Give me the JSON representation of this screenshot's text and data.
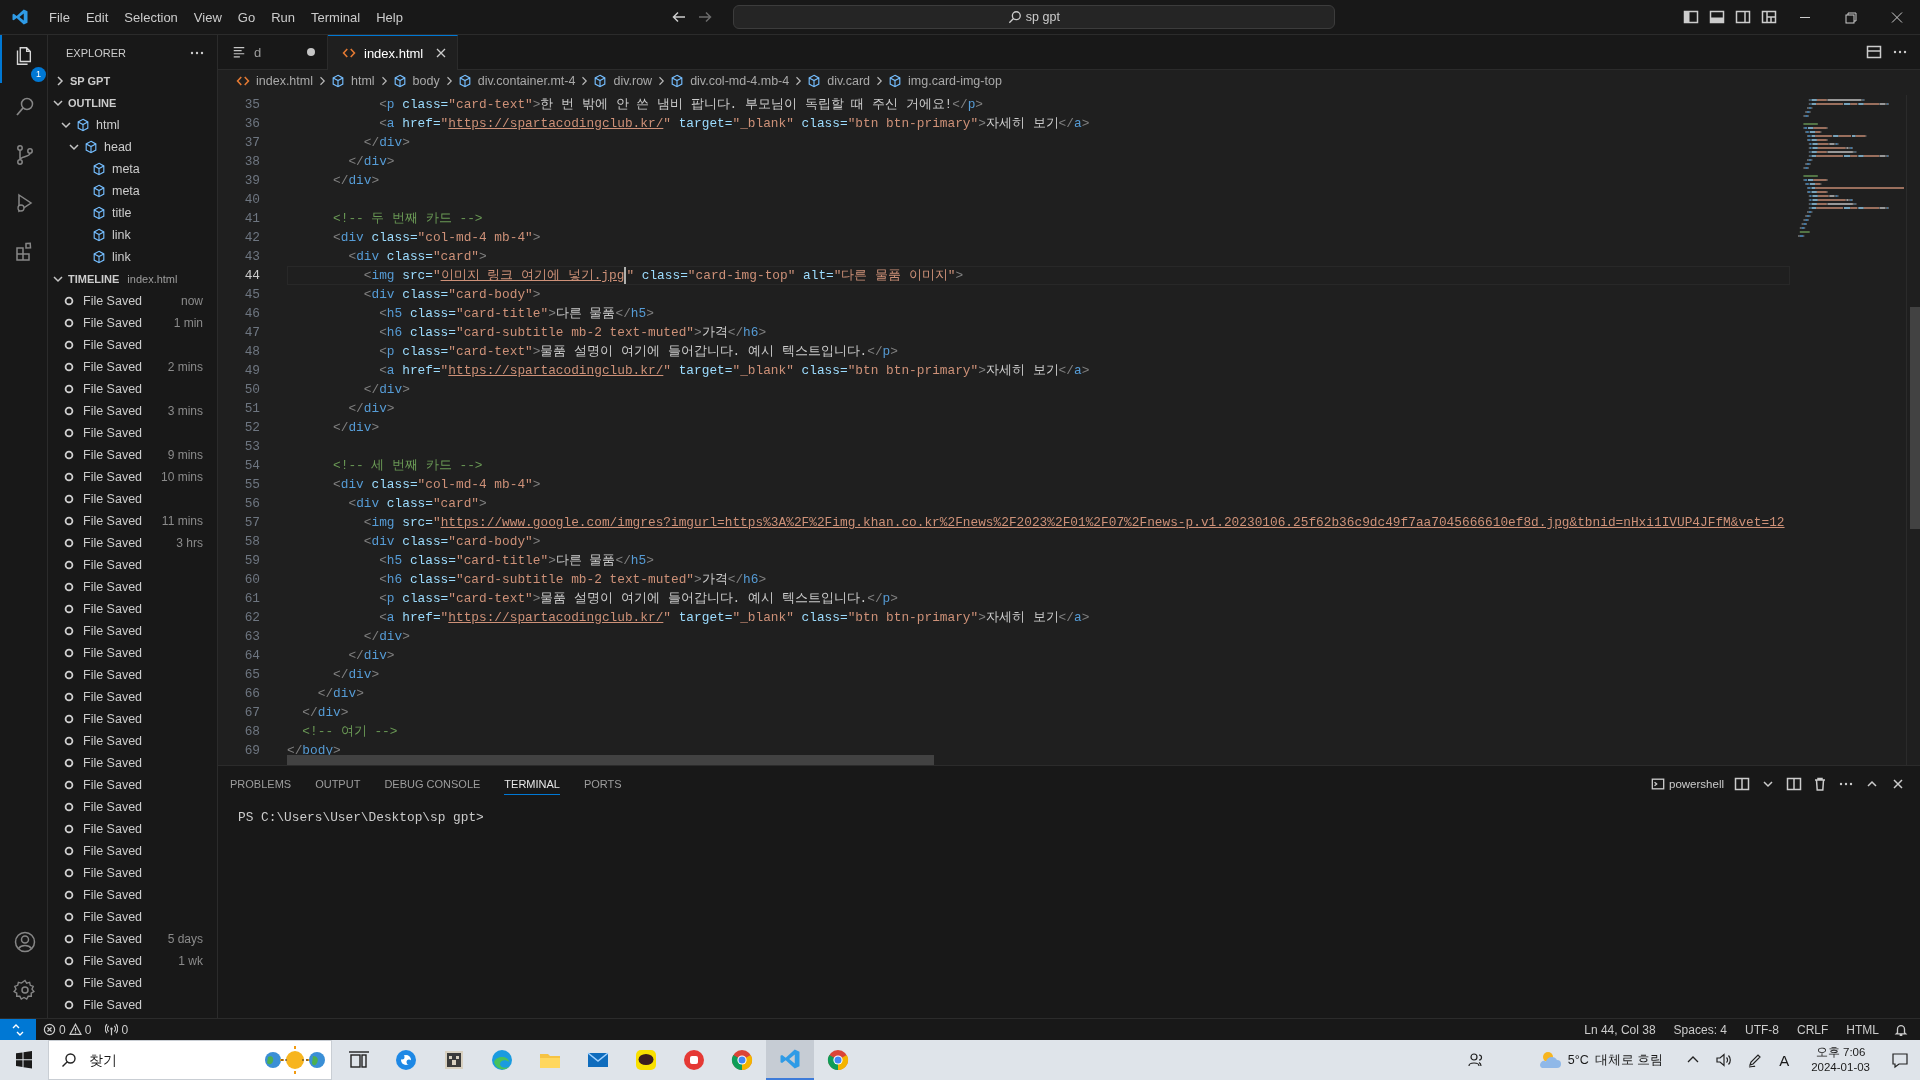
{
  "title_bar": {
    "menu": [
      "File",
      "Edit",
      "Selection",
      "View",
      "Go",
      "Run",
      "Terminal",
      "Help"
    ],
    "command_center": {
      "value": "sp gpt"
    }
  },
  "activity_bar": {
    "items": [
      {
        "kind": "explorer",
        "selected": true,
        "badge": "1"
      },
      {
        "kind": "search",
        "selected": false
      },
      {
        "kind": "source-control",
        "selected": false
      },
      {
        "kind": "run",
        "selected": false
      },
      {
        "kind": "extensions",
        "selected": false
      }
    ],
    "bottom": [
      {
        "kind": "accounts"
      },
      {
        "kind": "manage"
      }
    ]
  },
  "sidebar": {
    "title": "EXPLORER",
    "sections": [
      {
        "kind": "folder",
        "label": "SP GPT",
        "expanded": false
      },
      {
        "kind": "outline",
        "label": "OUTLINE",
        "expanded": true,
        "items": [
          {
            "label": "html",
            "expanded": true,
            "children": [
              {
                "label": "head",
                "expanded": true,
                "children": [
                  {
                    "label": "meta"
                  },
                  {
                    "label": "meta"
                  },
                  {
                    "label": "title"
                  },
                  {
                    "label": "link"
                  },
                  {
                    "label": "link"
                  }
                ]
              }
            ]
          }
        ]
      },
      {
        "kind": "timeline",
        "label": "TIMELINE",
        "file": "index.html",
        "expanded": true,
        "items": [
          {
            "label": "File Saved",
            "time": "now"
          },
          {
            "label": "File Saved",
            "time": "1 min"
          },
          {
            "label": "File Saved"
          },
          {
            "label": "File Saved",
            "time": "2 mins"
          },
          {
            "label": "File Saved"
          },
          {
            "label": "File Saved",
            "time": "3 mins"
          },
          {
            "label": "File Saved"
          },
          {
            "label": "File Saved",
            "time": "9 mins"
          },
          {
            "label": "File Saved",
            "time": "10 mins"
          },
          {
            "label": "File Saved"
          },
          {
            "label": "File Saved",
            "time": "11 mins"
          },
          {
            "label": "File Saved",
            "time": "3 hrs"
          },
          {
            "label": "File Saved"
          },
          {
            "label": "File Saved"
          },
          {
            "label": "File Saved"
          },
          {
            "label": "File Saved"
          },
          {
            "label": "File Saved"
          },
          {
            "label": "File Saved"
          },
          {
            "label": "File Saved"
          },
          {
            "label": "File Saved"
          },
          {
            "label": "File Saved"
          },
          {
            "label": "File Saved"
          },
          {
            "label": "File Saved"
          },
          {
            "label": "File Saved"
          },
          {
            "label": "File Saved"
          },
          {
            "label": "File Saved"
          },
          {
            "label": "File Saved"
          },
          {
            "label": "File Saved"
          },
          {
            "label": "File Saved"
          },
          {
            "label": "File Saved",
            "time": "5 days"
          },
          {
            "label": "File Saved",
            "time": "1 wk"
          },
          {
            "label": "File Saved"
          },
          {
            "label": "File Saved"
          }
        ]
      }
    ]
  },
  "editor": {
    "tabs": [
      {
        "label": "d",
        "kind": "text",
        "modified": true,
        "selected": false
      },
      {
        "label": "index.html",
        "kind": "html",
        "modified": false,
        "selected": true
      }
    ],
    "breadcrumbs": [
      {
        "label": "index.html",
        "kind": "file"
      },
      {
        "label": "html",
        "kind": "element"
      },
      {
        "label": "body",
        "kind": "element"
      },
      {
        "label": "div.container.mt-4",
        "kind": "element"
      },
      {
        "label": "div.row",
        "kind": "element"
      },
      {
        "label": "div.col-md-4.mb-4",
        "kind": "element"
      },
      {
        "label": "div.card",
        "kind": "element"
      },
      {
        "label": "img.card-img-top",
        "kind": "element"
      }
    ],
    "lines": [
      {
        "number": "35",
        "current": false,
        "tokens": [
          {
            "kind": "punct",
            "text": "            <"
          },
          {
            "kind": "tag",
            "text": "p"
          },
          {
            "kind": "attr",
            "text": " class="
          },
          {
            "kind": "str",
            "text": "\"card-text\""
          },
          {
            "kind": "punct",
            "text": ">"
          },
          {
            "kind": "text",
            "text": "한 번 밖에 안 쓴 냄비 팝니다. 부모님이 독립할 때 주신 거에요!"
          },
          {
            "kind": "punct",
            "text": "</"
          },
          {
            "kind": "tag",
            "text": "p"
          },
          {
            "kind": "punct",
            "text": ">"
          }
        ]
      },
      {
        "number": "36",
        "current": false,
        "tokens": [
          {
            "kind": "punct",
            "text": "            <"
          },
          {
            "kind": "tag",
            "text": "a"
          },
          {
            "kind": "attr",
            "text": " href="
          },
          {
            "kind": "str",
            "text": "\""
          },
          {
            "kind": "link",
            "text": "https://spartacodingclub.kr/"
          },
          {
            "kind": "str",
            "text": "\""
          },
          {
            "kind": "attr",
            "text": " target="
          },
          {
            "kind": "str",
            "text": "\"_blank\""
          },
          {
            "kind": "attr",
            "text": " class="
          },
          {
            "kind": "str",
            "text": "\"btn btn-primary\""
          },
          {
            "kind": "punct",
            "text": ">"
          },
          {
            "kind": "text",
            "text": "자세히 보기"
          },
          {
            "kind": "punct",
            "text": "</"
          },
          {
            "kind": "tag",
            "text": "a"
          },
          {
            "kind": "punct",
            "text": ">"
          }
        ]
      },
      {
        "number": "37",
        "current": false,
        "tokens": [
          {
            "kind": "punct",
            "text": "          </"
          },
          {
            "kind": "tag",
            "text": "div"
          },
          {
            "kind": "punct",
            "text": ">"
          }
        ]
      },
      {
        "number": "38",
        "current": false,
        "tokens": [
          {
            "kind": "punct",
            "text": "        </"
          },
          {
            "kind": "tag",
            "text": "div"
          },
          {
            "kind": "punct",
            "text": ">"
          }
        ]
      },
      {
        "number": "39",
        "current": false,
        "tokens": [
          {
            "kind": "punct",
            "text": "      </"
          },
          {
            "kind": "tag",
            "text": "div"
          },
          {
            "kind": "punct",
            "text": ">"
          }
        ]
      },
      {
        "number": "40",
        "current": false
      },
      {
        "number": "41",
        "current": false,
        "tokens": [
          {
            "kind": "comment",
            "text": "      <!-- 두 번째 카드 -->"
          }
        ]
      },
      {
        "number": "42",
        "current": false,
        "tokens": [
          {
            "kind": "punct",
            "text": "      <"
          },
          {
            "kind": "tag",
            "text": "div"
          },
          {
            "kind": "attr",
            "text": " class="
          },
          {
            "kind": "str",
            "text": "\"col-md-4 mb-4\""
          },
          {
            "kind": "punct",
            "text": ">"
          }
        ]
      },
      {
        "number": "43",
        "current": false,
        "tokens": [
          {
            "kind": "punct",
            "text": "        <"
          },
          {
            "kind": "tag",
            "text": "div"
          },
          {
            "kind": "attr",
            "text": " class="
          },
          {
            "kind": "str",
            "text": "\"card\""
          },
          {
            "kind": "punct",
            "text": ">"
          }
        ]
      },
      {
        "number": "44",
        "current": true,
        "tokens": [
          {
            "kind": "punct",
            "text": "          <"
          },
          {
            "kind": "tag",
            "text": "img"
          },
          {
            "kind": "attr",
            "text": " src="
          },
          {
            "kind": "str",
            "text": "\""
          },
          {
            "kind": "link",
            "text": "이미지_링크_여기에_넣기.jpg",
            "cursor": true
          },
          {
            "kind": "str",
            "text": "\""
          },
          {
            "kind": "attr",
            "text": " class="
          },
          {
            "kind": "str",
            "text": "\"card-img-top\""
          },
          {
            "kind": "attr",
            "text": " alt="
          },
          {
            "kind": "str",
            "text": "\"다른 물품 이미지\""
          },
          {
            "kind": "punct",
            "text": ">"
          }
        ]
      },
      {
        "number": "45",
        "current": false,
        "tokens": [
          {
            "kind": "punct",
            "text": "          <"
          },
          {
            "kind": "tag",
            "text": "div"
          },
          {
            "kind": "attr",
            "text": " class="
          },
          {
            "kind": "str",
            "text": "\"card-body\""
          },
          {
            "kind": "punct",
            "text": ">"
          }
        ]
      },
      {
        "number": "46",
        "current": false,
        "tokens": [
          {
            "kind": "punct",
            "text": "            <"
          },
          {
            "kind": "tag",
            "text": "h5"
          },
          {
            "kind": "attr",
            "text": " class="
          },
          {
            "kind": "str",
            "text": "\"card-title\""
          },
          {
            "kind": "punct",
            "text": ">"
          },
          {
            "kind": "text",
            "text": "다른 물품"
          },
          {
            "kind": "punct",
            "text": "</"
          },
          {
            "kind": "tag",
            "text": "h5"
          },
          {
            "kind": "punct",
            "text": ">"
          }
        ]
      },
      {
        "number": "47",
        "current": false,
        "tokens": [
          {
            "kind": "punct",
            "text": "            <"
          },
          {
            "kind": "tag",
            "text": "h6"
          },
          {
            "kind": "attr",
            "text": " class="
          },
          {
            "kind": "str",
            "text": "\"card-subtitle mb-2 text-muted\""
          },
          {
            "kind": "punct",
            "text": ">"
          },
          {
            "kind": "text",
            "text": "가격"
          },
          {
            "kind": "punct",
            "text": "</"
          },
          {
            "kind": "tag",
            "text": "h6"
          },
          {
            "kind": "punct",
            "text": ">"
          }
        ]
      },
      {
        "number": "48",
        "current": false,
        "tokens": [
          {
            "kind": "punct",
            "text": "            <"
          },
          {
            "kind": "tag",
            "text": "p"
          },
          {
            "kind": "attr",
            "text": " class="
          },
          {
            "kind": "str",
            "text": "\"card-text\""
          },
          {
            "kind": "punct",
            "text": ">"
          },
          {
            "kind": "text",
            "text": "물품 설명이 여기에 들어갑니다. 예시 텍스트입니다."
          },
          {
            "kind": "punct",
            "text": "</"
          },
          {
            "kind": "tag",
            "text": "p"
          },
          {
            "kind": "punct",
            "text": ">"
          }
        ]
      },
      {
        "number": "49",
        "current": false,
        "tokens": [
          {
            "kind": "punct",
            "text": "            <"
          },
          {
            "kind": "tag",
            "text": "a"
          },
          {
            "kind": "attr",
            "text": " href="
          },
          {
            "kind": "str",
            "text": "\""
          },
          {
            "kind": "link",
            "text": "https://spartacodingclub.kr/"
          },
          {
            "kind": "str",
            "text": "\""
          },
          {
            "kind": "attr",
            "text": " target="
          },
          {
            "kind": "str",
            "text": "\"_blank\""
          },
          {
            "kind": "attr",
            "text": " class="
          },
          {
            "kind": "str",
            "text": "\"btn btn-primary\""
          },
          {
            "kind": "punct",
            "text": ">"
          },
          {
            "kind": "text",
            "text": "자세히 보기"
          },
          {
            "kind": "punct",
            "text": "</"
          },
          {
            "kind": "tag",
            "text": "a"
          },
          {
            "kind": "punct",
            "text": ">"
          }
        ]
      },
      {
        "number": "50",
        "current": false,
        "tokens": [
          {
            "kind": "punct",
            "text": "          </"
          },
          {
            "kind": "tag",
            "text": "div"
          },
          {
            "kind": "punct",
            "text": ">"
          }
        ]
      },
      {
        "number": "51",
        "current": false,
        "tokens": [
          {
            "kind": "punct",
            "text": "        </"
          },
          {
            "kind": "tag",
            "text": "div"
          },
          {
            "kind": "punct",
            "text": ">"
          }
        ]
      },
      {
        "number": "52",
        "current": false,
        "tokens": [
          {
            "kind": "punct",
            "text": "      </"
          },
          {
            "kind": "tag",
            "text": "div"
          },
          {
            "kind": "punct",
            "text": ">"
          }
        ]
      },
      {
        "number": "53",
        "current": false
      },
      {
        "number": "54",
        "current": false,
        "tokens": [
          {
            "kind": "comment",
            "text": "      <!-- 세 번째 카드 -->"
          }
        ]
      },
      {
        "number": "55",
        "current": false,
        "tokens": [
          {
            "kind": "punct",
            "text": "      <"
          },
          {
            "kind": "tag",
            "text": "div"
          },
          {
            "kind": "attr",
            "text": " class="
          },
          {
            "kind": "str",
            "text": "\"col-md-4 mb-4\""
          },
          {
            "kind": "punct",
            "text": ">"
          }
        ]
      },
      {
        "number": "56",
        "current": false,
        "tokens": [
          {
            "kind": "punct",
            "text": "        <"
          },
          {
            "kind": "tag",
            "text": "div"
          },
          {
            "kind": "attr",
            "text": " class="
          },
          {
            "kind": "str",
            "text": "\"card\""
          },
          {
            "kind": "punct",
            "text": ">"
          }
        ]
      },
      {
        "number": "57",
        "current": false,
        "tokens": [
          {
            "kind": "punct",
            "text": "          <"
          },
          {
            "kind": "tag",
            "text": "img"
          },
          {
            "kind": "attr",
            "text": " src="
          },
          {
            "kind": "str",
            "text": "\""
          },
          {
            "kind": "link",
            "text": "https://www.google.com/imgres?imgurl=https%3A%2F%2Fimg.khan.co.kr%2Fnews%2F2023%2F01%2F07%2Fnews-p.v1.20230106.25f62b36c9dc49f7aa7045666610ef8d.jpg&tbnid=nHxi1IVUP4JFfM&vet=12"
          }
        ]
      },
      {
        "number": "58",
        "current": false,
        "tokens": [
          {
            "kind": "punct",
            "text": "          <"
          },
          {
            "kind": "tag",
            "text": "div"
          },
          {
            "kind": "attr",
            "text": " class="
          },
          {
            "kind": "str",
            "text": "\"card-body\""
          },
          {
            "kind": "punct",
            "text": ">"
          }
        ]
      },
      {
        "number": "59",
        "current": false,
        "tokens": [
          {
            "kind": "punct",
            "text": "            <"
          },
          {
            "kind": "tag",
            "text": "h5"
          },
          {
            "kind": "attr",
            "text": " class="
          },
          {
            "kind": "str",
            "text": "\"card-title\""
          },
          {
            "kind": "punct",
            "text": ">"
          },
          {
            "kind": "text",
            "text": "다른 물품"
          },
          {
            "kind": "punct",
            "text": "</"
          },
          {
            "kind": "tag",
            "text": "h5"
          },
          {
            "kind": "punct",
            "text": ">"
          }
        ]
      },
      {
        "number": "60",
        "current": false,
        "tokens": [
          {
            "kind": "punct",
            "text": "            <"
          },
          {
            "kind": "tag",
            "text": "h6"
          },
          {
            "kind": "attr",
            "text": " class="
          },
          {
            "kind": "str",
            "text": "\"card-subtitle mb-2 text-muted\""
          },
          {
            "kind": "punct",
            "text": ">"
          },
          {
            "kind": "text",
            "text": "가격"
          },
          {
            "kind": "punct",
            "text": "</"
          },
          {
            "kind": "tag",
            "text": "h6"
          },
          {
            "kind": "punct",
            "text": ">"
          }
        ]
      },
      {
        "number": "61",
        "current": false,
        "tokens": [
          {
            "kind": "punct",
            "text": "            <"
          },
          {
            "kind": "tag",
            "text": "p"
          },
          {
            "kind": "attr",
            "text": " class="
          },
          {
            "kind": "str",
            "text": "\"card-text\""
          },
          {
            "kind": "punct",
            "text": ">"
          },
          {
            "kind": "text",
            "text": "물품 설명이 여기에 들어갑니다. 예시 텍스트입니다."
          },
          {
            "kind": "punct",
            "text": "</"
          },
          {
            "kind": "tag",
            "text": "p"
          },
          {
            "kind": "punct",
            "text": ">"
          }
        ]
      },
      {
        "number": "62",
        "current": false,
        "tokens": [
          {
            "kind": "punct",
            "text": "            <"
          },
          {
            "kind": "tag",
            "text": "a"
          },
          {
            "kind": "attr",
            "text": " href="
          },
          {
            "kind": "str",
            "text": "\""
          },
          {
            "kind": "link",
            "text": "https://spartacodingclub.kr/"
          },
          {
            "kind": "str",
            "text": "\""
          },
          {
            "kind": "attr",
            "text": " target="
          },
          {
            "kind": "str",
            "text": "\"_blank\""
          },
          {
            "kind": "attr",
            "text": " class="
          },
          {
            "kind": "str",
            "text": "\"btn btn-primary\""
          },
          {
            "kind": "punct",
            "text": ">"
          },
          {
            "kind": "text",
            "text": "자세히 보기"
          },
          {
            "kind": "punct",
            "text": "</"
          },
          {
            "kind": "tag",
            "text": "a"
          },
          {
            "kind": "punct",
            "text": ">"
          }
        ]
      },
      {
        "number": "63",
        "current": false,
        "tokens": [
          {
            "kind": "punct",
            "text": "          </"
          },
          {
            "kind": "tag",
            "text": "div"
          },
          {
            "kind": "punct",
            "text": ">"
          }
        ]
      },
      {
        "number": "64",
        "current": false,
        "tokens": [
          {
            "kind": "punct",
            "text": "        </"
          },
          {
            "kind": "tag",
            "text": "div"
          },
          {
            "kind": "punct",
            "text": ">"
          }
        ]
      },
      {
        "number": "65",
        "current": false,
        "tokens": [
          {
            "kind": "punct",
            "text": "      </"
          },
          {
            "kind": "tag",
            "text": "div"
          },
          {
            "kind": "punct",
            "text": ">"
          }
        ]
      },
      {
        "number": "66",
        "current": false,
        "tokens": [
          {
            "kind": "punct",
            "text": "    </"
          },
          {
            "kind": "tag",
            "text": "div"
          },
          {
            "kind": "punct",
            "text": ">"
          }
        ]
      },
      {
        "number": "67",
        "current": false,
        "tokens": [
          {
            "kind": "punct",
            "text": "  </"
          },
          {
            "kind": "tag",
            "text": "div"
          },
          {
            "kind": "punct",
            "text": ">"
          }
        ]
      },
      {
        "number": "68",
        "current": false,
        "tokens": [
          {
            "kind": "comment",
            "text": "  <!-- 여기 -->"
          }
        ]
      },
      {
        "number": "69",
        "current": false,
        "tokens": [
          {
            "kind": "punct",
            "text": "</"
          },
          {
            "kind": "tag",
            "text": "body"
          },
          {
            "kind": "punct",
            "text": ">"
          }
        ]
      }
    ]
  },
  "panel": {
    "tabs": [
      {
        "label": "PROBLEMS",
        "selected": false
      },
      {
        "label": "OUTPUT",
        "selected": false
      },
      {
        "label": "DEBUG CONSOLE",
        "selected": false
      },
      {
        "label": "TERMINAL",
        "selected": true
      },
      {
        "label": "PORTS",
        "selected": false
      }
    ],
    "shell": "powershell",
    "terminal": [
      "PS C:\\Users\\User\\Desktop\\sp gpt>"
    ]
  },
  "status_bar": {
    "errors": "0",
    "warnings": "0",
    "ports": "0",
    "items": [
      "Ln 44, Col 38",
      "Spaces: 4",
      "UTF-8",
      "CRLF",
      "HTML"
    ]
  },
  "taskbar": {
    "search": {
      "placeholder": "찾기"
    },
    "apps": [
      {
        "kind": "task-view",
        "active": false
      },
      {
        "kind": "globe",
        "active": false
      },
      {
        "kind": "block",
        "active": false
      },
      {
        "kind": "edge",
        "active": false
      },
      {
        "kind": "files",
        "active": false
      },
      {
        "kind": "mail",
        "active": false
      },
      {
        "kind": "chat",
        "active": false
      },
      {
        "kind": "red",
        "active": false
      },
      {
        "kind": "chrome",
        "active": false
      },
      {
        "kind": "code",
        "active": true
      },
      {
        "kind": "chrome",
        "active": false
      }
    ],
    "weather": {
      "temperature": "5°C",
      "condition": "대체로 흐림"
    },
    "input_mode": "A",
    "clock": {
      "time": "오후 7:06",
      "date": "2024-01-03"
    }
  }
}
